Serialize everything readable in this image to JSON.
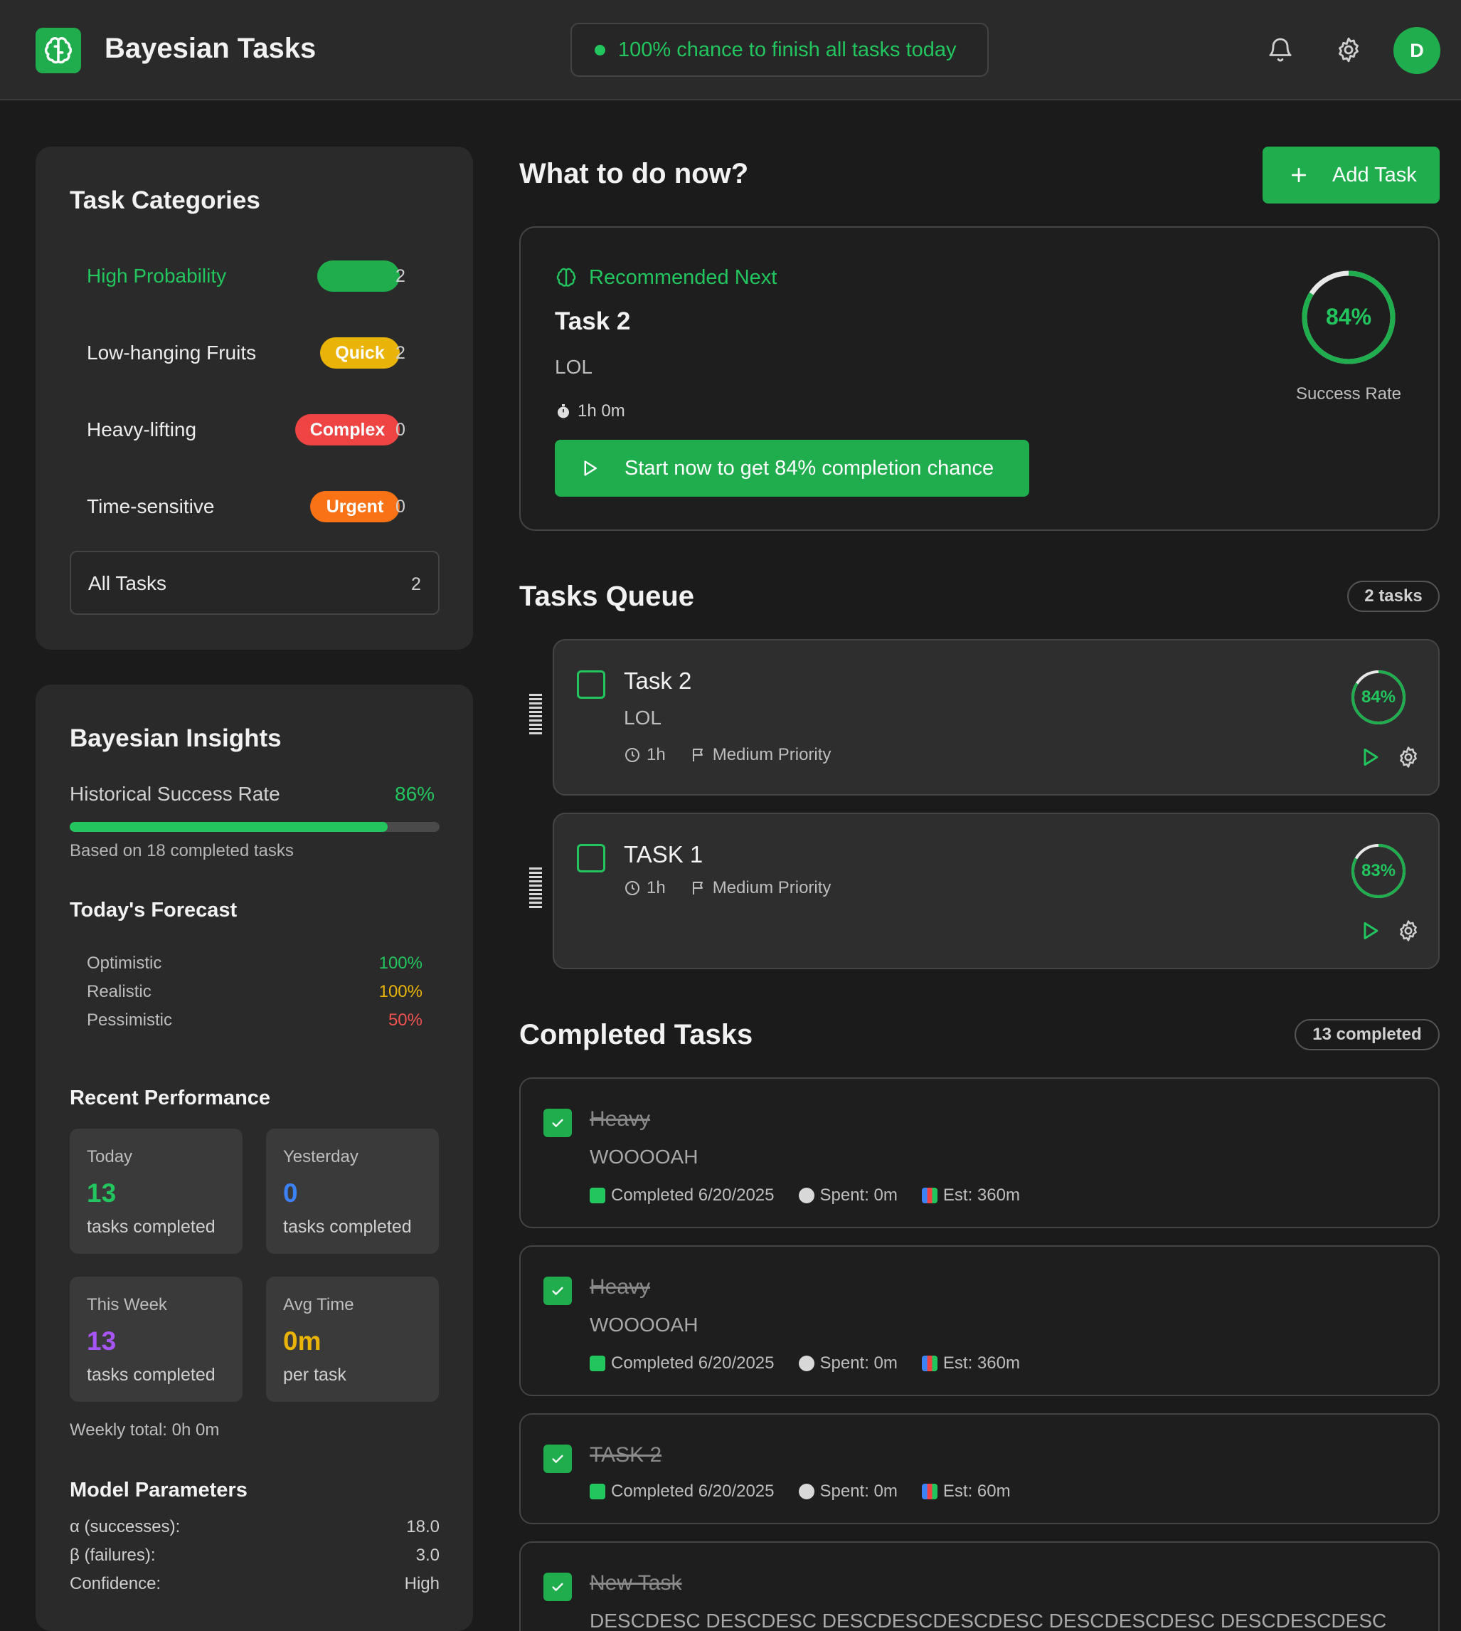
{
  "header": {
    "title": "Bayesian Tasks",
    "status": "100% chance to finish all tasks today",
    "avatar_initial": "D"
  },
  "categories": {
    "title": "Task Categories",
    "items": [
      {
        "label": "High Probability",
        "badge": "",
        "count": "2",
        "color": "#1fad4e"
      },
      {
        "label": "Low-hanging Fruits",
        "badge": "Quick",
        "count": "2",
        "color": "#eab308"
      },
      {
        "label": "Heavy-lifting",
        "badge": "Complex",
        "count": "0",
        "color": "#ef4444"
      },
      {
        "label": "Time-sensitive",
        "badge": "Urgent",
        "count": "0",
        "color": "#f97316"
      }
    ],
    "all": {
      "label": "All Tasks",
      "count": "2"
    }
  },
  "insights": {
    "title": "Bayesian Insights",
    "historical_label": "Historical Success Rate",
    "historical_value": "86%",
    "historical_fraction": 0.86,
    "based_on": "Based on 18 completed tasks",
    "forecast_title": "Today's Forecast",
    "forecast": [
      {
        "label": "Optimistic",
        "value": "100%",
        "color": "#22c55e"
      },
      {
        "label": "Realistic",
        "value": "100%",
        "color": "#eab308"
      },
      {
        "label": "Pessimistic",
        "value": "50%",
        "color": "#ef5350"
      }
    ],
    "performance_title": "Recent Performance",
    "performance": [
      {
        "label": "Today",
        "value": "13",
        "sub": "tasks completed",
        "color": "#22c55e"
      },
      {
        "label": "Yesterday",
        "value": "0",
        "sub": "tasks completed",
        "color": "#3b82f6"
      },
      {
        "label": "This Week",
        "value": "13",
        "sub": "tasks completed",
        "color": "#a855f7"
      },
      {
        "label": "Avg Time",
        "value": "0m",
        "sub": "per task",
        "color": "#eab308"
      }
    ],
    "weekly_total": "Weekly total: 0h 0m",
    "params_title": "Model Parameters",
    "params": [
      {
        "label": "α (successes):",
        "value": "18.0"
      },
      {
        "label": "β (failures):",
        "value": "3.0"
      },
      {
        "label": "Confidence:",
        "value": "High"
      }
    ]
  },
  "now": {
    "title": "What to do now?",
    "add_label": "Add Task",
    "rec_label": "Recommended Next",
    "task_title": "Task 2",
    "task_desc": "LOL",
    "duration": "1h 0m",
    "start_label": "Start now to get 84% completion chance",
    "success_value": "84%",
    "success_fraction": 0.84,
    "success_label": "Success Rate"
  },
  "queue": {
    "title": "Tasks Queue",
    "count": "2 tasks",
    "items": [
      {
        "title": "Task 2",
        "desc": "LOL",
        "duration": "1h",
        "priority": "Medium Priority",
        "pct": "84%",
        "fraction": 0.84
      },
      {
        "title": "TASK 1",
        "desc": "",
        "duration": "1h",
        "priority": "Medium Priority",
        "pct": "83%",
        "fraction": 0.83
      }
    ]
  },
  "completed": {
    "title": "Completed Tasks",
    "count": "13 completed",
    "items": [
      {
        "title": "Heavy",
        "desc": "WOOOOAH",
        "completed": "Completed 6/20/2025",
        "spent": "Spent: 0m",
        "est": "Est: 360m"
      },
      {
        "title": "Heavy",
        "desc": "WOOOOAH",
        "completed": "Completed 6/20/2025",
        "spent": "Spent: 0m",
        "est": "Est: 360m"
      },
      {
        "title": "TASK 2",
        "desc": "",
        "completed": "Completed 6/20/2025",
        "spent": "Spent: 0m",
        "est": "Est: 60m"
      },
      {
        "title": "New Task",
        "desc": "DESCDESC DESCDESC DESCDESCDESCDESC DESCDESCDESC DESCDESCDESC"
      }
    ]
  }
}
